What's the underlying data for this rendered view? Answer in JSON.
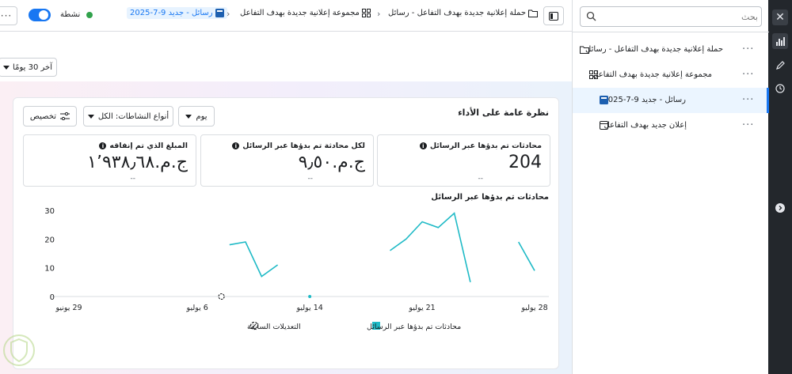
{
  "topbar": {
    "more_label": "···",
    "status_label": "نشطة",
    "breadcrumbs": [
      {
        "label": "حملة إعلانية جديدة بهدف التفاعل - رسائل",
        "icon": "folder-icon"
      },
      {
        "label": "مجموعة إعلانية جديدة بهدف التفاعل",
        "icon": "grid-icon"
      },
      {
        "label": "رسائل - جديد 9-7-2025",
        "icon": "ad-square-icon"
      }
    ]
  },
  "sidepanel": {
    "search_placeholder": "بحث",
    "tree": [
      {
        "label": "حملة إعلانية جديدة بهدف التفاعل - رسائل",
        "icon": "folder-icon",
        "selected": false
      },
      {
        "label": "مجموعة إعلانية جديدة بهدف التفاعل",
        "icon": "grid-icon",
        "selected": false
      },
      {
        "label": "رسائل - جديد 9-7-2025",
        "icon": "ad-square-icon",
        "selected": true
      },
      {
        "label": "إعلان جديد بهدف التفاعل",
        "icon": "ad-outline-icon",
        "selected": false
      }
    ],
    "more_label": "···"
  },
  "date_range": {
    "label": "آخر 30 يومًا"
  },
  "overview": {
    "title": "نظرة عامة على الأداء",
    "controls": {
      "day": "يوم",
      "activity": "أنواع النشاطات: الكل",
      "customize": "تخصيص"
    },
    "metrics": [
      {
        "label": "محادثات تم بدؤها عبر الرسائل",
        "value": "204",
        "delta": "--"
      },
      {
        "label": "لكل محادثة تم بدؤها عبر الرسائل",
        "value": "ج.م.‏٩٫٥٠",
        "delta": "--"
      },
      {
        "label": "المبلغ الذي تم إنفاقه",
        "value": "ج.م.‏١٬٩٣٨٫٦٨",
        "delta": "--"
      }
    ],
    "chart_title": "محادثات تم بدؤها عبر الرسائل",
    "legend": {
      "series": "محادثات تم بدؤها عبر الرسائل",
      "edits": "التعديلات السابقة"
    }
  },
  "chart_data": {
    "type": "line",
    "title": "محادثات تم بدؤها عبر الرسائل",
    "ylim": [
      0,
      30
    ],
    "yticks": [
      0,
      10,
      20,
      30
    ],
    "xlim": [
      0,
      29
    ],
    "xticks": [
      {
        "pos": 0,
        "label": "28 يوليو"
      },
      {
        "pos": 7,
        "label": "21 يوليو"
      },
      {
        "pos": 14,
        "label": "14 يوليو"
      },
      {
        "pos": 21,
        "label": "6 يوليو"
      },
      {
        "pos": 29,
        "label": "29 يونيو"
      }
    ],
    "grid": false,
    "series": [
      {
        "name": "محادثات تم بدؤها عبر الرسائل",
        "color": "#1fbac6",
        "segments": [
          [
            [
              0,
              9
            ],
            [
              1,
              19
            ]
          ],
          [
            [
              4,
              5
            ],
            [
              5,
              29
            ],
            [
              6,
              24
            ],
            [
              7,
              26
            ],
            [
              8,
              20
            ],
            [
              9,
              16
            ]
          ],
          [
            [
              14,
              0
            ]
          ],
          [
            [
              16,
              11
            ],
            [
              17,
              7
            ],
            [
              18,
              19
            ],
            [
              19,
              18
            ]
          ]
        ]
      }
    ],
    "edit_markers": [
      19.5
    ]
  },
  "colors": {
    "accent": "#1877f2",
    "series": "#1fbac6",
    "active": "#31a24c"
  }
}
